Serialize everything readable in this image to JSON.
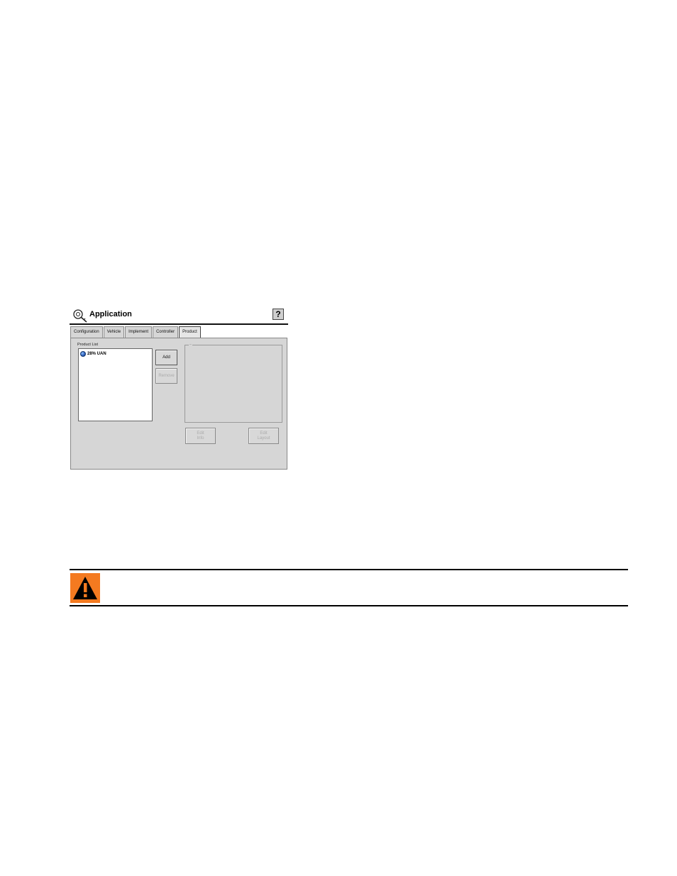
{
  "window": {
    "title": "Application",
    "help_label": "?"
  },
  "tabs": [
    {
      "label": "Configuration",
      "active": false
    },
    {
      "label": "Vehicle",
      "active": false
    },
    {
      "label": "Implement",
      "active": false
    },
    {
      "label": "Controller",
      "active": false
    },
    {
      "label": "Product",
      "active": true
    }
  ],
  "product_list": {
    "label": "Product List",
    "items": [
      {
        "label": "28% UAN",
        "icon": "globe-icon"
      }
    ]
  },
  "buttons": {
    "add": "Add",
    "remove": "Remove",
    "edit_info_line1": "Edit",
    "edit_info_line2": "Info",
    "edit_layout_line1": "Edit",
    "edit_layout_line2": "Layout"
  },
  "details": {
    "caption": "–"
  },
  "warning": {
    "icon": "warning-icon",
    "color": "#f47a20"
  }
}
